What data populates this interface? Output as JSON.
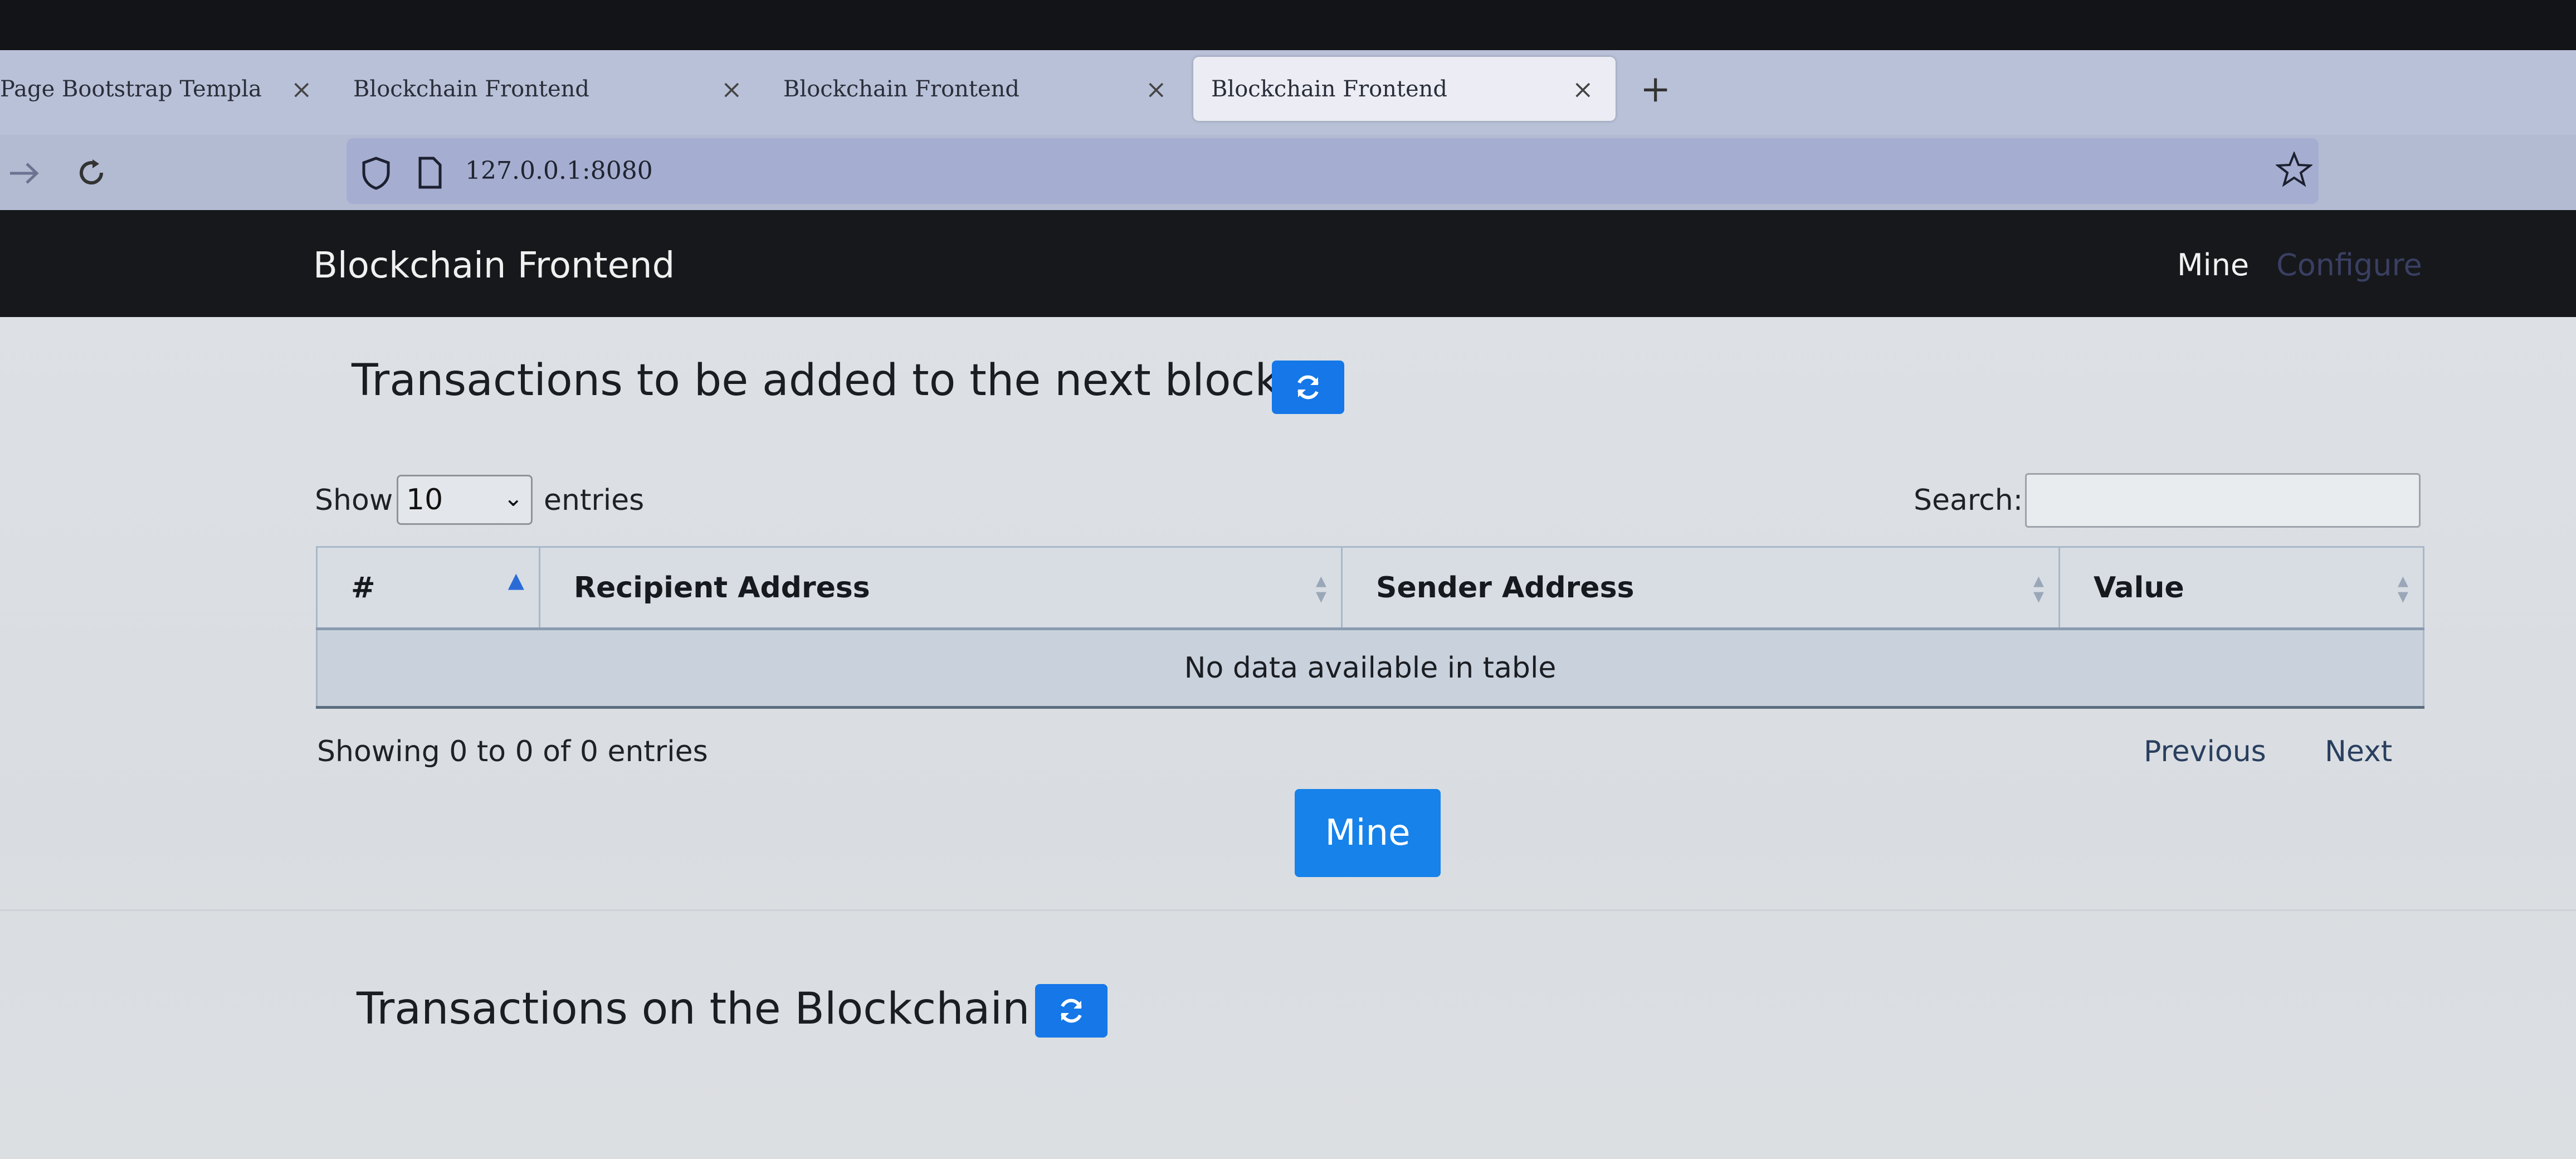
{
  "browser": {
    "tabs": [
      {
        "label": "Page Bootstrap Template",
        "active": false
      },
      {
        "label": "Blockchain Frontend",
        "active": false
      },
      {
        "label": "Blockchain Frontend",
        "active": false
      },
      {
        "label": "Blockchain Frontend",
        "active": true
      }
    ],
    "tab_close_glyph": "×",
    "new_tab_glyph": "+",
    "address": "127.0.0.1:8080",
    "icons": [
      "forward-arrow-icon",
      "reload-icon",
      "shield-icon",
      "page-icon",
      "star-icon"
    ]
  },
  "navbar": {
    "brand": "Blockchain Frontend",
    "links": [
      "Mine",
      "Configure"
    ]
  },
  "pending": {
    "title": "Transactions to be added to the next block",
    "show_label": "Show",
    "page_length": "10",
    "entries_label": "entries",
    "search_label": "Search:",
    "columns": [
      "#",
      "Recipient Address",
      "Sender Address",
      "Value"
    ],
    "empty_message": "No data available in table",
    "info": "Showing 0 to 0 of 0 entries",
    "previous": "Previous",
    "next": "Next",
    "mine_button": "Mine"
  },
  "chain": {
    "title": "Transactions on the Blockchain"
  },
  "colors": {
    "primary_button": "#1682ea",
    "navbar_bg": "#16181b",
    "sort_active": "#2a6bd6"
  }
}
